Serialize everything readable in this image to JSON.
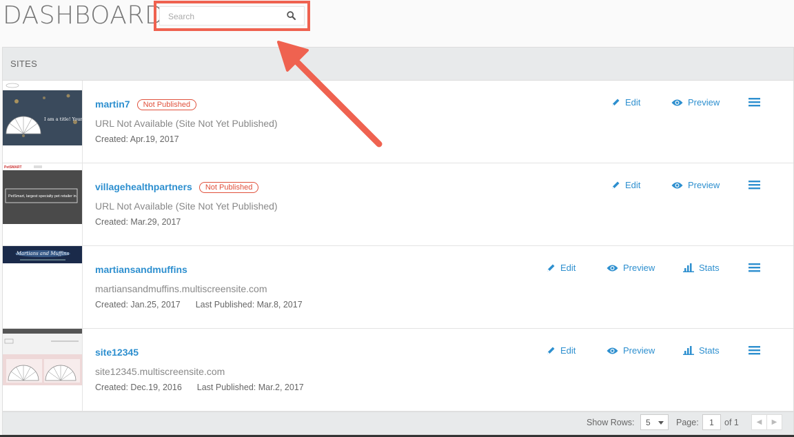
{
  "header": {
    "title": "DASHBOARD",
    "search_placeholder": "Search"
  },
  "panel": {
    "title": "SITES"
  },
  "actions": {
    "edit": "Edit",
    "preview": "Preview",
    "stats": "Stats"
  },
  "sites": [
    {
      "name": "martin7",
      "badge": "Not Published",
      "url": "URL Not Available (Site Not Yet Published)",
      "created": "Created: Apr.19, 2017",
      "last_published": "",
      "thumb_text": "I am a title! Your bakery's name goes here"
    },
    {
      "name": "villagehealthpartners",
      "badge": "Not Published",
      "url": "URL Not Available (Site Not Yet Published)",
      "created": "Created: Mar.29, 2017",
      "last_published": "",
      "thumb_text": "PetSmart, largest specialty pet retailer in"
    },
    {
      "name": "martiansandmuffins",
      "badge": "",
      "url": "martiansandmuffins.multiscreensite.com",
      "created": "Created: Jan.25, 2017",
      "last_published": "Last Published: Mar.8, 2017",
      "thumb_text": "Martians and Muffins"
    },
    {
      "name": "site12345",
      "badge": "",
      "url": "site12345.multiscreensite.com",
      "created": "Created: Dec.19, 2016",
      "last_published": "Last Published: Mar.2, 2017",
      "thumb_text": ""
    }
  ],
  "footer": {
    "show_rows_label": "Show Rows:",
    "rows_value": "5",
    "page_label": "Page:",
    "page_value": "1",
    "of_label": "of 1"
  },
  "colors": {
    "accent": "#2d8fcf",
    "badge": "#e0503b",
    "highlight": "#ef6250"
  },
  "icons": [
    "search-icon",
    "pencil-icon",
    "eye-icon",
    "bar-chart-icon",
    "hamburger-menu-icon",
    "chevron-left-icon",
    "chevron-right-icon"
  ]
}
